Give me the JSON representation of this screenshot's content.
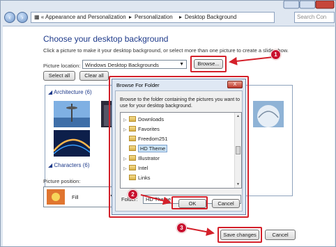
{
  "window": {
    "breadcrumb": [
      "Appearance and Personalization",
      "Personalization",
      "Desktop Background"
    ],
    "search_placeholder": "Search Con",
    "icons": {
      "back": "back-arrow-icon",
      "forward": "forward-arrow-icon",
      "folder": "control-panel-icon",
      "search": "search-icon"
    }
  },
  "main": {
    "title": "Choose your desktop background",
    "subtitle": "Click a picture to make it your desktop background, or select more than one picture to create a slide show.",
    "picture_location_label": "Picture location:",
    "picture_location_value": "Windows Desktop Backgrounds",
    "browse_label": "Browse...",
    "select_all_label": "Select all",
    "clear_all_label": "Clear all",
    "groups": [
      {
        "label": "Architecture (6)"
      },
      {
        "label": "Characters (6)"
      }
    ],
    "picture_position_label": "Picture position:",
    "picture_position_value": "Fill",
    "save_label": "Save changes",
    "cancel_label": "Cancel"
  },
  "dialog": {
    "title": "Browse For Folder",
    "close_label": "X",
    "description": "Browse to the folder containing the pictures you want to use for your desktop background.",
    "tree_items": [
      {
        "label": "Downloads",
        "expandable": true,
        "selected": false
      },
      {
        "label": "Favorites",
        "expandable": true,
        "selected": false
      },
      {
        "label": "Freedom251",
        "expandable": false,
        "selected": false
      },
      {
        "label": "HD Theme",
        "expandable": false,
        "selected": true
      },
      {
        "label": "Illustrator",
        "expandable": true,
        "selected": false
      },
      {
        "label": "Intel",
        "expandable": true,
        "selected": false
      },
      {
        "label": "Links",
        "expandable": false,
        "selected": false
      }
    ],
    "folder_label": "Folder:",
    "folder_value": "HD Theme",
    "ok_label": "OK",
    "cancel_label": "Cancel"
  },
  "annotations": [
    {
      "label": "1"
    },
    {
      "label": "2"
    },
    {
      "label": "3"
    }
  ],
  "colors": {
    "highlight": "#d4202a",
    "accent_title": "#1e3a8a"
  }
}
